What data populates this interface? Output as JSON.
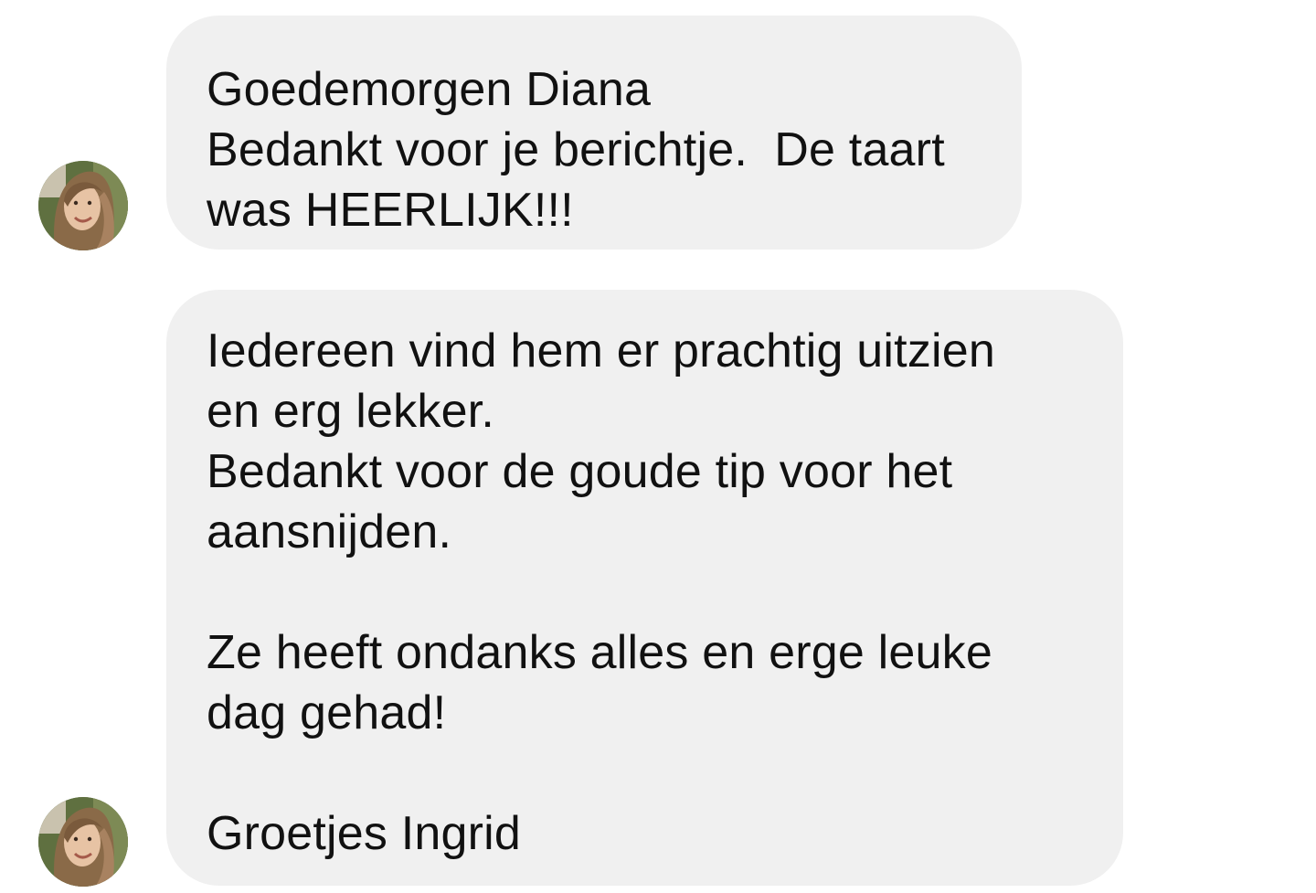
{
  "messages": [
    {
      "sender_avatar": "profile-photo-avatar",
      "lines": [
        "Goedemorgen Diana",
        "Bedankt voor je berichtje.  De taart",
        "was HEERLIJK!!!"
      ]
    },
    {
      "sender_avatar": "profile-photo-avatar",
      "lines": [
        "Iedereen vind hem er prachtig uitzien",
        "en erg lekker.",
        "Bedankt voor de goude tip voor het",
        "aansnijden.",
        "",
        "Ze heeft ondanks alles en erge leuke",
        "dag gehad!",
        "",
        "Groetjes Ingrid"
      ]
    }
  ],
  "colors": {
    "bubble_background": "#f0f0f0",
    "text": "#111111",
    "page_background": "#ffffff"
  }
}
